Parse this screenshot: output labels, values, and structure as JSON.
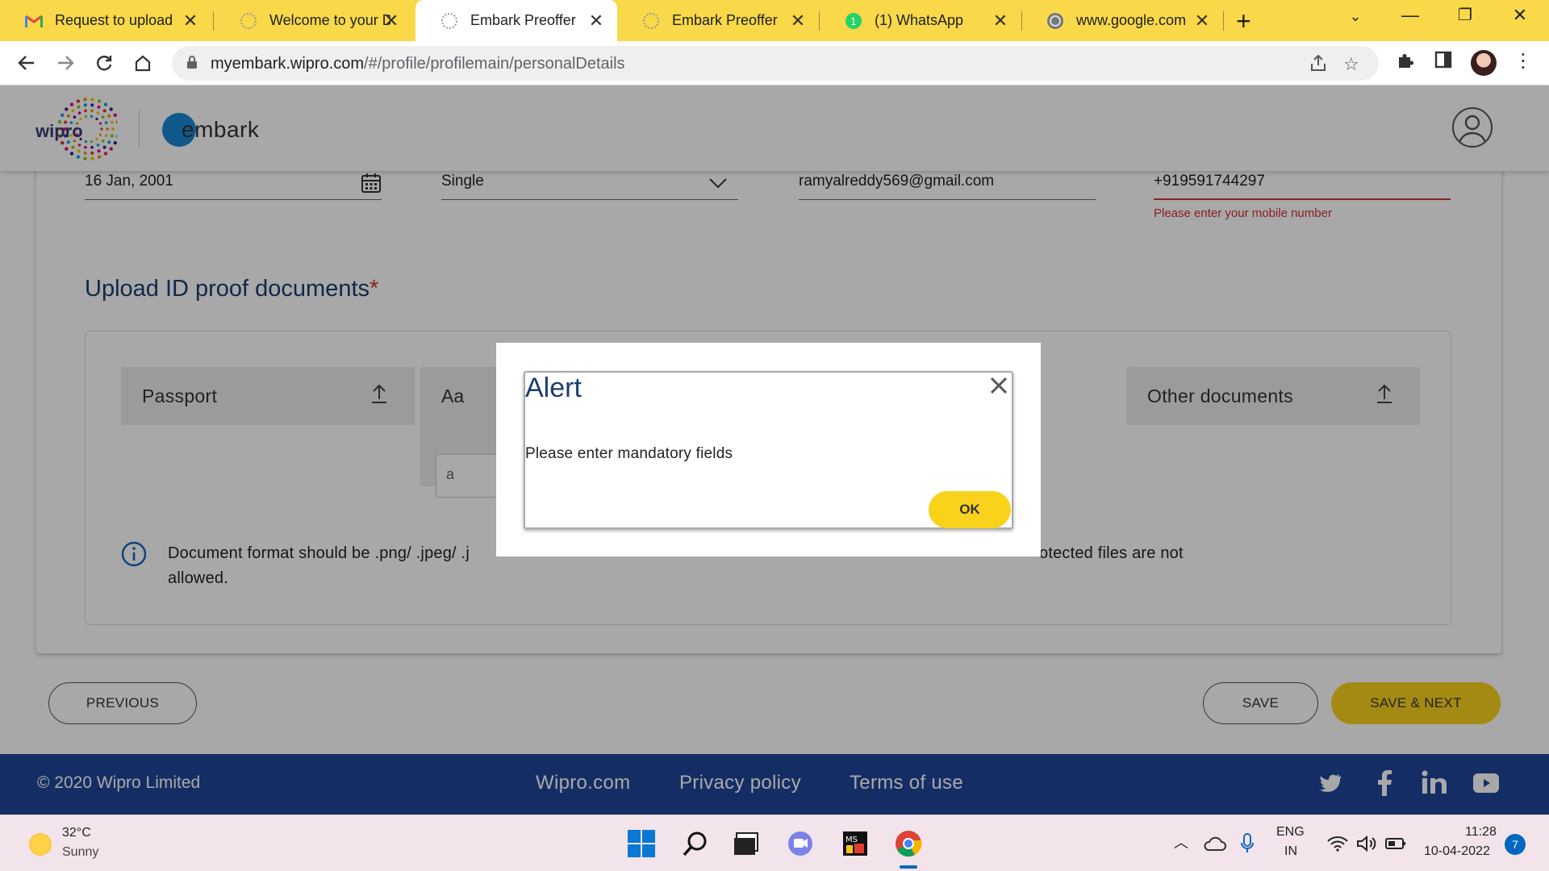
{
  "browser": {
    "tabs": [
      {
        "title": "Request to upload",
        "icon": "gmail-icon"
      },
      {
        "title": "Welcome to your D",
        "icon": "wipro-favicon"
      },
      {
        "title": "Embark Preoffer",
        "icon": "wipro-favicon",
        "active": true
      },
      {
        "title": "Embark Preoffer",
        "icon": "wipro-favicon"
      },
      {
        "title": "(1) WhatsApp",
        "icon": "whatsapp-icon"
      },
      {
        "title": "www.google.com",
        "icon": "globe-icon"
      }
    ],
    "url_host": "myembark.wipro.com",
    "url_path": "/#/profile/profilemain/personalDetails"
  },
  "header": {
    "logo_text": "wipro",
    "app_name": "embark"
  },
  "form": {
    "dob": "16 Jan, 2001",
    "marital_status": "Single",
    "email": "ramyalreddy569@gmail.com",
    "mobile": "+919591744297",
    "mobile_error": "Please enter your mobile number"
  },
  "upload": {
    "title": "Upload ID proof documents",
    "required_mark": "*",
    "tiles": [
      "Passport",
      "Aa",
      "Other documents"
    ],
    "aadhaar_placeholder": "a",
    "info_text": "Document format should be .png/ .jpeg/ .j",
    "info_text_tail": "otected files are not",
    "info_text_line2": "allowed."
  },
  "buttons": {
    "previous": "PREVIOUS",
    "save": "SAVE",
    "save_next": "SAVE & NEXT"
  },
  "footer": {
    "copyright": "© 2020 Wipro Limited",
    "links": [
      "Wipro.com",
      "Privacy policy",
      "Terms of use"
    ],
    "social": [
      "twitter-icon",
      "facebook-icon",
      "linkedin-icon",
      "youtube-icon"
    ]
  },
  "alert": {
    "title": "Alert",
    "message": "Please enter mandatory fields",
    "ok": "OK"
  },
  "taskbar": {
    "temperature": "32°C",
    "weather": "Sunny",
    "lang": "ENG",
    "region": "IN",
    "time": "11:28",
    "date": "10-04-2022",
    "notifications": "7"
  },
  "colors": {
    "tabbar": "#f9d84a",
    "footer": "#1f4799",
    "accent_yellow": "#f9d21c",
    "title_blue": "#1a3d6d",
    "error_red": "#d32f2f"
  }
}
